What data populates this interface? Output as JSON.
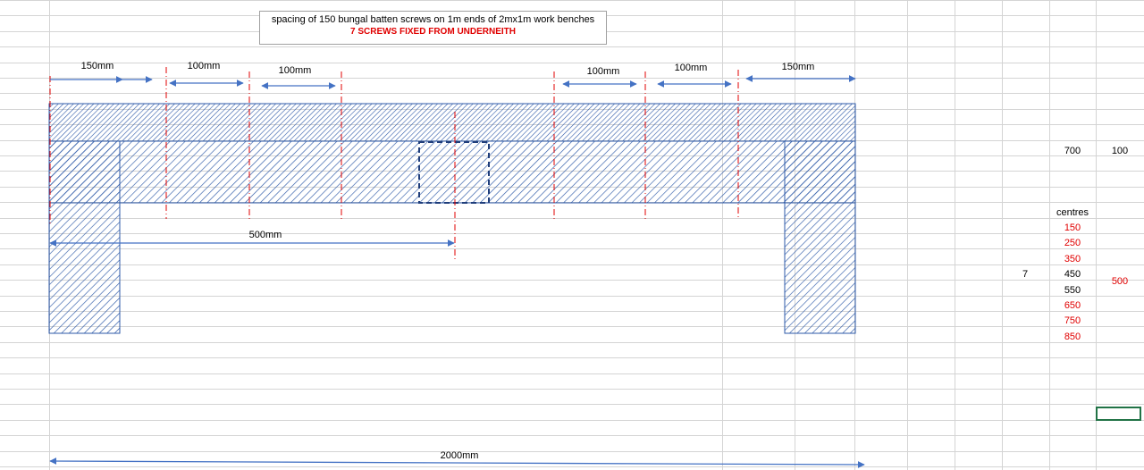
{
  "note": {
    "line1": "spacing of 150 bungal batten screws  on 1m ends of 2mx1m work benches",
    "line2": "7 SCREWS FIXED FROM UNDERNEITH"
  },
  "dimensions": {
    "left_150": "150mm",
    "gap_1": "100mm",
    "gap_2": "100mm",
    "gap_3": "100mm",
    "gap_4": "100mm",
    "right_150": "150mm",
    "half_500": "500mm",
    "total_2000": "2000mm"
  },
  "cells": {
    "c700": "700",
    "c100": "100",
    "centres_label": "centres",
    "count": "7",
    "c500": "500",
    "centres": [
      {
        "value": "150",
        "color": "red"
      },
      {
        "value": "250",
        "color": "red"
      },
      {
        "value": "350",
        "color": "red"
      },
      {
        "value": "450",
        "color": "black"
      },
      {
        "value": "550",
        "color": "black"
      },
      {
        "value": "650",
        "color": "red"
      },
      {
        "value": "750",
        "color": "red"
      },
      {
        "value": "850",
        "color": "red"
      }
    ]
  },
  "colors": {
    "gridline": "#d4d4d4",
    "hatch_blue": "#2e5aa8",
    "arrow_blue": "#4472c4",
    "red_dash": "#e00000",
    "red_text": "#e00000",
    "selection": "#217346"
  }
}
